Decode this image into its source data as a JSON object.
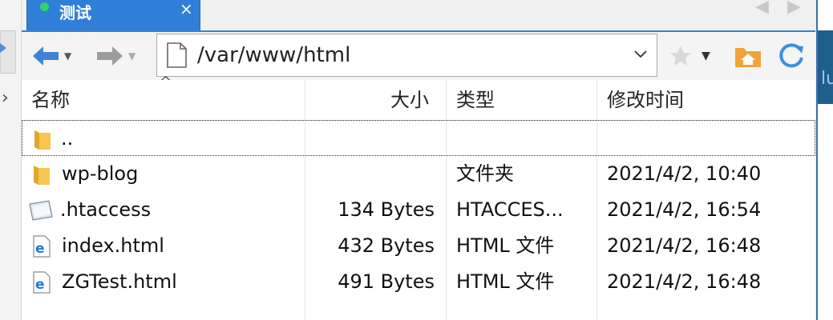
{
  "window": {
    "tab_title": "测试",
    "tab_close": "×",
    "tab_nav_prev": "◀",
    "tab_nav_next": "▶"
  },
  "toolbar": {
    "address": "/var/www/html",
    "colors": {
      "accent": "#2f7fd8",
      "nav_arrow": "#3d84d6",
      "folder": "#f0b941",
      "refresh": "#3d8ee0"
    }
  },
  "columns": {
    "name": "名称",
    "size": "大小",
    "type": "类型",
    "modified": "修改时间"
  },
  "files": [
    {
      "icon": "folder-icon",
      "name": "..",
      "size": "",
      "type": "",
      "modified": ""
    },
    {
      "icon": "folder-icon",
      "name": "wp-blog",
      "size": "",
      "type": "文件夹",
      "modified": "2021/4/2, 10:40"
    },
    {
      "icon": "generic-file-icon",
      "name": ".htaccess",
      "size": "134 Bytes",
      "type": "HTACCES...",
      "modified": "2021/4/2, 16:54"
    },
    {
      "icon": "html-file-icon",
      "name": "index.html",
      "size": "432 Bytes",
      "type": "HTML 文件",
      "modified": "2021/4/2, 16:48"
    },
    {
      "icon": "html-file-icon",
      "name": "ZGTest.html",
      "size": "491 Bytes",
      "type": "HTML 文件",
      "modified": "2021/4/2, 16:48"
    }
  ]
}
